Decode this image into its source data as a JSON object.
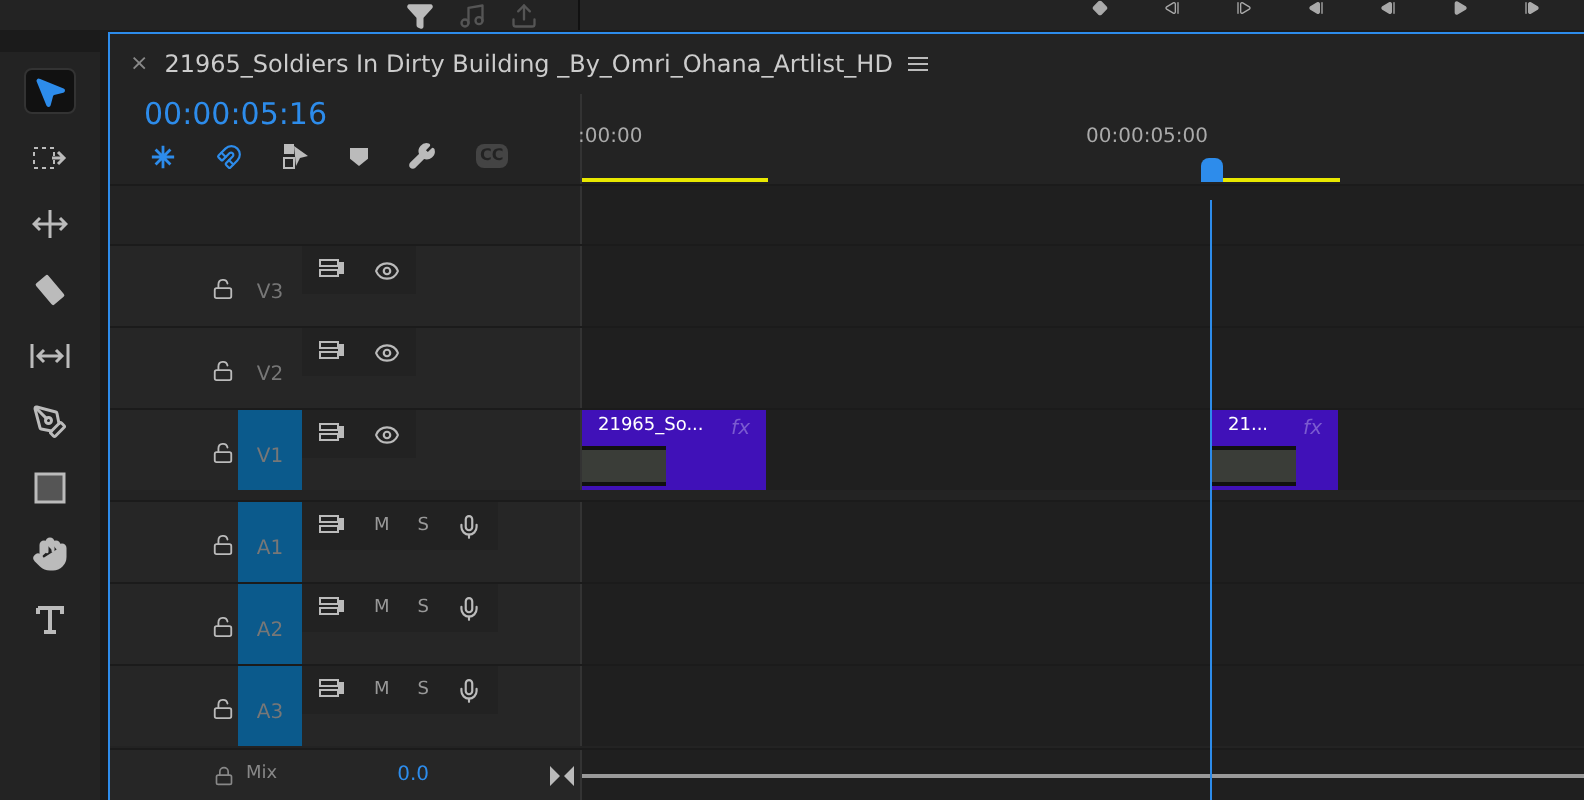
{
  "sequence_tab": {
    "title": "21965_Soldiers In Dirty Building _By_Omri_Ohana_Artlist_HD",
    "close": "×"
  },
  "timecode": "00:00:05:16",
  "captions_button": "CC",
  "ruler": {
    "labels": [
      ":00:00",
      "00:00:05:00"
    ]
  },
  "tools": [
    {
      "kind": "select",
      "selected": true
    },
    {
      "kind": "track-select",
      "selected": false
    },
    {
      "kind": "ripple",
      "selected": false
    },
    {
      "kind": "razor",
      "selected": false
    },
    {
      "kind": "slip",
      "selected": false
    },
    {
      "kind": "pen",
      "selected": false
    },
    {
      "kind": "rectangle",
      "selected": false
    },
    {
      "kind": "hand",
      "selected": false
    },
    {
      "kind": "type",
      "selected": false
    }
  ],
  "tracks": [
    {
      "kind": "video",
      "name": "V3",
      "targeted": false
    },
    {
      "kind": "video",
      "name": "V2",
      "targeted": false
    },
    {
      "kind": "video",
      "name": "V1",
      "targeted": true,
      "clips": [
        {
          "label": "21965_So...",
          "fx": "fx"
        },
        {
          "label": "21...",
          "fx": "fx"
        }
      ]
    },
    {
      "kind": "audio",
      "name": "A1",
      "targeted": true,
      "mute": "M",
      "solo": "S"
    },
    {
      "kind": "audio",
      "name": "A2",
      "targeted": true,
      "mute": "M",
      "solo": "S"
    },
    {
      "kind": "audio",
      "name": "A3",
      "targeted": true,
      "mute": "M",
      "solo": "S"
    }
  ],
  "mix": {
    "label": "Mix",
    "value": "0.0"
  }
}
